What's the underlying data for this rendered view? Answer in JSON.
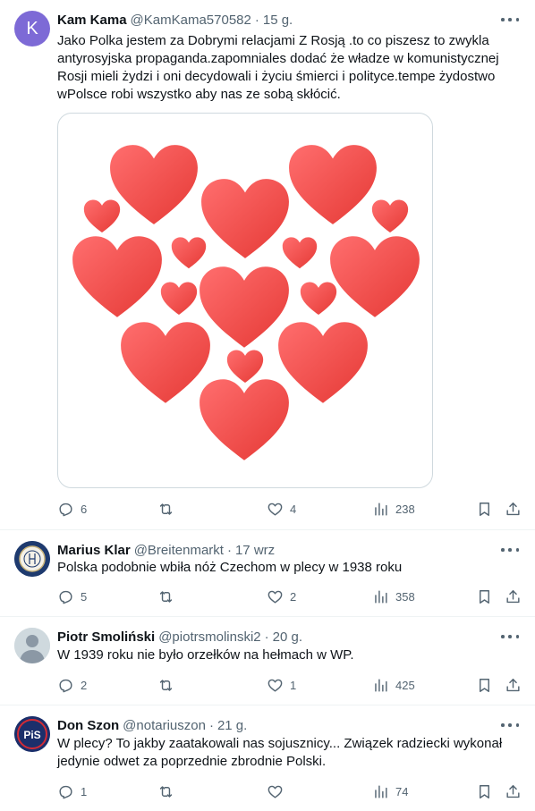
{
  "tweets": [
    {
      "name": "Kam Kama",
      "handle": "@KamKama570582",
      "time": "15 g.",
      "avatar_letter": "K",
      "text": "Jako Polka jestem za Dobrymi relacjami Z Rosją .to co piszesz to zwykla antyrosyjska propaganda.zapomniales dodać że władze w komunistycznej Rosji mieli żydzi i oni decydowali i życiu śmierci i polityce.tempe żydostwo wPolsce robi wszystko aby nas ze sobą skłócić.",
      "replies": "6",
      "retweets": "",
      "likes": "4",
      "views": "238"
    },
    {
      "name": "Marius Klar",
      "handle": "@Breitenmarkt",
      "time": "17 wrz",
      "text": "Polska podobnie wbiła nóż Czechom w plecy w 1938 roku",
      "replies": "5",
      "retweets": "",
      "likes": "2",
      "views": "358"
    },
    {
      "name": "Piotr Smoliński",
      "handle": "@piotrsmolinski2",
      "time": "20 g.",
      "text": "W 1939 roku nie było orzełków na hełmach w WP.",
      "replies": "2",
      "retweets": "",
      "likes": "1",
      "views": "425"
    },
    {
      "name": "Don Szon",
      "handle": "@notariuszon",
      "time": "21 g.",
      "avatar_text": "PiS",
      "text": "W plecy? To jakby zaatakowali nas sojusznicy... Związek radziecki wykonał jedynie odwet za poprzednie zbrodnie Polski.",
      "replies": "1",
      "retweets": "",
      "likes": "",
      "views": "74"
    }
  ],
  "colors": {
    "text": "#0f1419",
    "secondary": "#536471",
    "border": "#eff3f4",
    "heart_light": "#ff6b6b",
    "heart_dark": "#e53935"
  },
  "icons": [
    "more-icon",
    "reply-icon",
    "retweet-icon",
    "like-icon",
    "views-icon",
    "bookmark-icon",
    "share-icon"
  ]
}
